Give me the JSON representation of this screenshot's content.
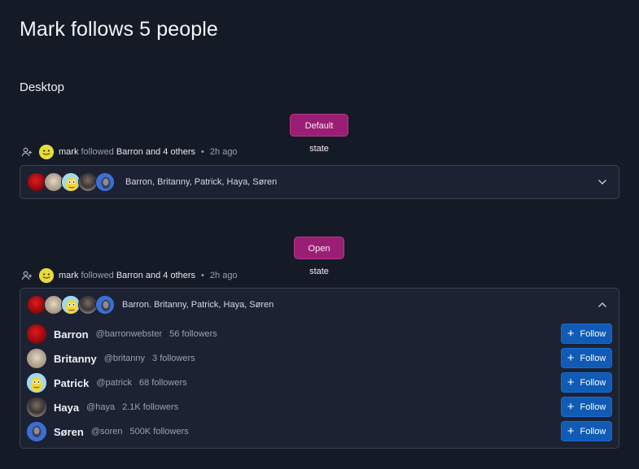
{
  "page": {
    "title": "Mark follows 5 people",
    "section": "Desktop"
  },
  "colors": {
    "background": "#151a27",
    "pill": "#9a1f74",
    "follow_button": "#0f5bb5",
    "card": "#1c2232"
  },
  "states": [
    {
      "label": "Default state",
      "activity": {
        "actor": "mark",
        "verb": "followed",
        "target": "Barron and 4 others",
        "separator": "•",
        "time": "2h ago"
      },
      "names": "Barron, Britanny, Patrick, Haya, Søren",
      "chevron": "chevron-down-icon"
    },
    {
      "label": "Open state",
      "activity": {
        "actor": "mark",
        "verb": "followed",
        "target": "Barron and 4 others",
        "separator": "•",
        "time": "2h ago"
      },
      "names": "Barron. Britanny, Patrick, Haya, Søren",
      "chevron": "chevron-up-icon",
      "people": [
        {
          "name": "Barron",
          "handle": "@barronwebster",
          "followers": "56 followers",
          "button": "Follow"
        },
        {
          "name": "Britanny",
          "handle": "@britanny",
          "followers": "3 followers",
          "button": "Follow"
        },
        {
          "name": "Patrick",
          "handle": "@patrick",
          "followers": "68 followers",
          "button": "Follow"
        },
        {
          "name": "Haya",
          "handle": "@haya",
          "followers": "2.1K followers",
          "button": "Follow"
        },
        {
          "name": "Søren",
          "handle": "@soren",
          "followers": "500K followers",
          "button": "Follow"
        }
      ]
    }
  ]
}
